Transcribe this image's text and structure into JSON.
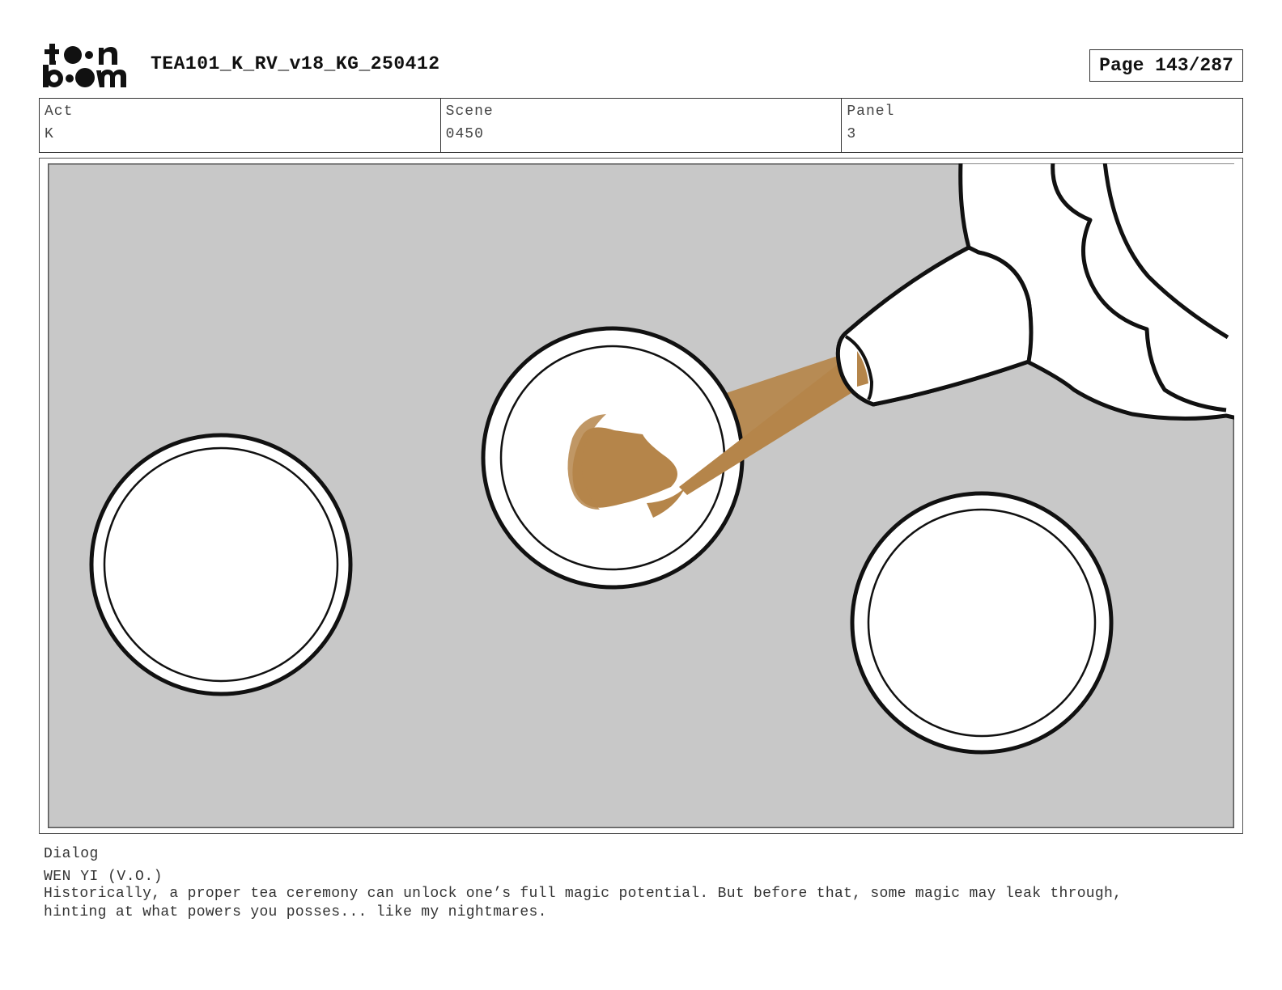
{
  "header": {
    "logo_text": "toon boom",
    "title": "TEA101_K_RV_v18_KG_250412",
    "page": "Page 143/287"
  },
  "info": [
    {
      "label": "Act",
      "value": "K"
    },
    {
      "label": "Scene",
      "value": "0450"
    },
    {
      "label": "Panel",
      "value": "3"
    }
  ],
  "dialog": {
    "label": "Dialog",
    "speaker": "WEN YI (V.O.)",
    "line1": "Historically, a proper tea ceremony can unlock one’s full magic potential. But before that, some magic may leak through,",
    "line2": "hinting at what powers you posses... like my nightmares."
  },
  "colors": {
    "background": "#c8c8c8",
    "tea": "#b5854a",
    "ink": "#111111"
  }
}
